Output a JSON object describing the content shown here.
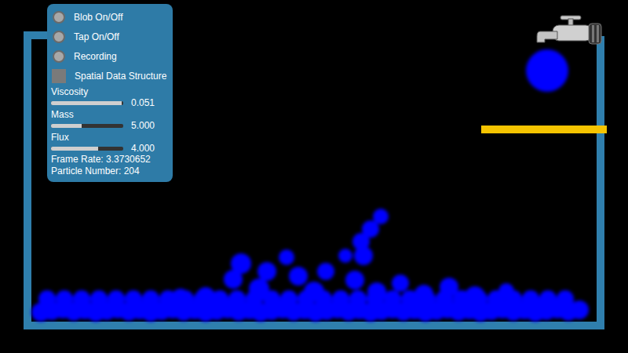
{
  "controls": {
    "toggles": [
      {
        "label": "Blob On/Off",
        "kind": "radio",
        "on": false
      },
      {
        "label": "Tap On/Off",
        "kind": "radio",
        "on": false
      },
      {
        "label": "Recording",
        "kind": "radio",
        "on": false
      },
      {
        "label": "Spatial Data Structure",
        "kind": "checkbox",
        "on": false
      }
    ],
    "sliders": [
      {
        "label": "Viscosity",
        "level": 0.98,
        "reading": "0.051"
      },
      {
        "label": "Mass",
        "level": 0.42,
        "reading": "5.000"
      },
      {
        "label": "Flux",
        "level": 0.65,
        "reading": "4.000"
      }
    ],
    "stats": [
      "Frame Rate: 3.3730652",
      "Particle Number: 204"
    ]
  }
}
